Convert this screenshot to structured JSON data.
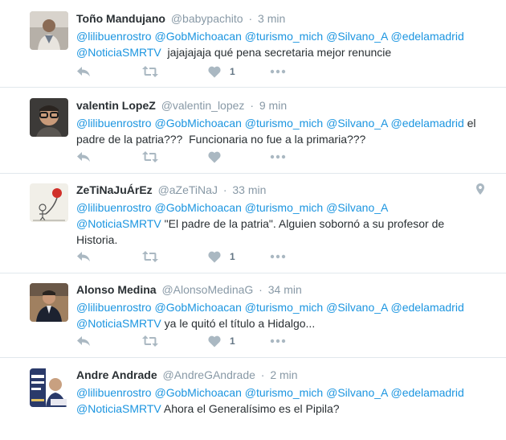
{
  "tweets": [
    {
      "fullname": "Toño Mandujano",
      "username": "@babypachito",
      "time": "3 min",
      "line1": [
        {
          "t": "@lilibuenrostro",
          "m": true
        },
        {
          "t": " ",
          "m": false
        },
        {
          "t": "@GobMichoacan",
          "m": true
        },
        {
          "t": " ",
          "m": false
        },
        {
          "t": "@turismo_mich",
          "m": true
        },
        {
          "t": " ",
          "m": false
        },
        {
          "t": "@Silvano_A",
          "m": true
        },
        {
          "t": " ",
          "m": false
        },
        {
          "t": "@edelamadrid",
          "m": true
        }
      ],
      "line2": [
        {
          "t": "@NoticiaSMRTV",
          "m": true
        },
        {
          "t": "  jajajajaja qué pena secretaria mejor renuncie",
          "m": false
        }
      ],
      "line3": [],
      "likes": "1",
      "has_location": false
    },
    {
      "fullname": "valentin LopeZ",
      "username": "@valentin_lopez",
      "time": "9 min",
      "line1": [
        {
          "t": "@lilibuenrostro",
          "m": true
        },
        {
          "t": " ",
          "m": false
        },
        {
          "t": "@GobMichoacan",
          "m": true
        },
        {
          "t": " ",
          "m": false
        },
        {
          "t": "@turismo_mich",
          "m": true
        },
        {
          "t": " ",
          "m": false
        },
        {
          "t": "@Silvano_A",
          "m": true
        },
        {
          "t": " ",
          "m": false
        },
        {
          "t": "@edelamadrid",
          "m": true
        },
        {
          "t": " el",
          "m": false
        }
      ],
      "line2": [
        {
          "t": "padre de la patria???  Funcionaria no fue a la primaria???",
          "m": false
        }
      ],
      "line3": [],
      "likes": "",
      "has_location": false
    },
    {
      "fullname": "ZeTiNaJuÁrEz",
      "username": "@aZeTiNaJ",
      "time": "33 min",
      "line1": [
        {
          "t": "@lilibuenrostro",
          "m": true
        },
        {
          "t": " ",
          "m": false
        },
        {
          "t": "@GobMichoacan",
          "m": true
        },
        {
          "t": " ",
          "m": false
        },
        {
          "t": "@turismo_mich",
          "m": true
        },
        {
          "t": " ",
          "m": false
        },
        {
          "t": "@Silvano_A",
          "m": true
        }
      ],
      "line2": [
        {
          "t": "@NoticiaSMRTV",
          "m": true
        },
        {
          "t": " \"El padre de la patria\". Alguien sobornó a su profesor de",
          "m": false
        }
      ],
      "line3": [
        {
          "t": "Historia.",
          "m": false
        }
      ],
      "likes": "1",
      "has_location": true
    },
    {
      "fullname": "Alonso Medina",
      "username": "@AlonsoMedinaG",
      "time": "34 min",
      "line1": [
        {
          "t": "@lilibuenrostro",
          "m": true
        },
        {
          "t": " ",
          "m": false
        },
        {
          "t": "@GobMichoacan",
          "m": true
        },
        {
          "t": " ",
          "m": false
        },
        {
          "t": "@turismo_mich",
          "m": true
        },
        {
          "t": " ",
          "m": false
        },
        {
          "t": "@Silvano_A",
          "m": true
        },
        {
          "t": " ",
          "m": false
        },
        {
          "t": "@edelamadrid",
          "m": true
        }
      ],
      "line2": [
        {
          "t": "@NoticiaSMRTV",
          "m": true
        },
        {
          "t": " ya le quitó el título a Hidalgo...",
          "m": false
        }
      ],
      "line3": [],
      "likes": "1",
      "has_location": false
    },
    {
      "fullname": "Andre Andrade",
      "username": "@AndreGAndrade",
      "time": "2 min",
      "line1": [
        {
          "t": "@lilibuenrostro",
          "m": true
        },
        {
          "t": " ",
          "m": false
        },
        {
          "t": "@GobMichoacan",
          "m": true
        },
        {
          "t": " ",
          "m": false
        },
        {
          "t": "@turismo_mich",
          "m": true
        },
        {
          "t": " ",
          "m": false
        },
        {
          "t": "@Silvano_A",
          "m": true
        },
        {
          "t": " ",
          "m": false
        },
        {
          "t": "@edelamadrid",
          "m": true
        }
      ],
      "line2": [
        {
          "t": "@NoticiaSMRTV",
          "m": true
        },
        {
          "t": " Ahora el Generalísimo es el Pipila?",
          "m": false
        }
      ],
      "line3": [],
      "likes": "",
      "has_location": false
    }
  ],
  "colors": {
    "mention": "#1b95e0",
    "icon": "#aab8c2",
    "muted": "#8899a6",
    "divider": "#e1e8ed"
  },
  "icons": [
    "reply-icon",
    "retweet-icon",
    "heart-icon",
    "more-icon",
    "location-pin-icon"
  ]
}
